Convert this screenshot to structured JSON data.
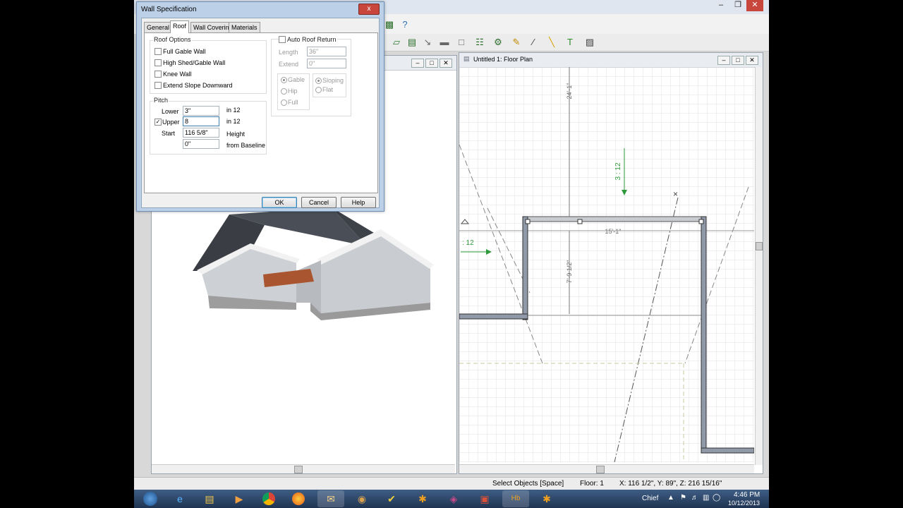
{
  "dialog": {
    "title": "Wall Specification",
    "close_label": "x",
    "tabs": [
      {
        "label": "General"
      },
      {
        "label": "Roof"
      },
      {
        "label": "Wall Covering"
      },
      {
        "label": "Materials"
      }
    ],
    "active_tab": "Roof",
    "roof_options": {
      "title": "Roof Options",
      "items": [
        {
          "label": "Full Gable Wall",
          "checked": false
        },
        {
          "label": "High Shed/Gable Wall",
          "checked": false
        },
        {
          "label": "Knee Wall",
          "checked": false
        },
        {
          "label": "Extend Slope Downward",
          "checked": false
        }
      ]
    },
    "pitch": {
      "title": "Pitch",
      "lower_label": "Lower",
      "lower_value": "3\"",
      "lower_unit": "in 12",
      "upper_label": "Upper",
      "upper_checked": true,
      "upper_value": "8",
      "upper_unit": "in 12",
      "start_label": "Start",
      "start_value": "116 5/8\"",
      "start_unit": "Height",
      "baseline_value": "0\"",
      "baseline_unit": "from Baseline"
    },
    "auto_return": {
      "label": "Auto Roof Return",
      "checked": false,
      "length_label": "Length",
      "length_value": "36\"",
      "extend_label": "Extend",
      "extend_value": "0\"",
      "type_options": [
        {
          "label": "Gable",
          "selected": true
        },
        {
          "label": "Hip",
          "selected": false
        },
        {
          "label": "Full",
          "selected": false
        }
      ],
      "slope_options": [
        {
          "label": "Sloping",
          "selected": true
        },
        {
          "label": "Flat",
          "selected": false
        }
      ]
    },
    "buttons": {
      "ok": "OK",
      "cancel": "Cancel",
      "help": "Help"
    }
  },
  "floor_plan": {
    "title": "Untitled 1: Floor Plan",
    "dimensions": {
      "top": "24'-1\"",
      "wall_width": "15'-1\"",
      "wall_depth": "7'-9 1/2\"",
      "pitch_marker": "3 : 12",
      "pitch_left": ": 12"
    }
  },
  "status_bar": {
    "mode": "Select Objects [Space]",
    "floor": "Floor: 1",
    "coords": "X: 116 1/2\", Y: 89\", Z: 216 15/16\""
  },
  "taskbar": {
    "apps": [
      {
        "icon": "start-orb-icon"
      },
      {
        "icon": "internet-explorer-icon"
      },
      {
        "icon": "file-explorer-icon"
      },
      {
        "icon": "media-player-icon"
      },
      {
        "icon": "chrome-icon"
      },
      {
        "icon": "firefox-icon"
      },
      {
        "icon": "outlook-icon"
      },
      {
        "icon": "paint-icon"
      },
      {
        "icon": "norton-icon"
      },
      {
        "icon": "chief-architect-icon"
      },
      {
        "icon": "corel-icon"
      },
      {
        "icon": "photo-app-icon"
      },
      {
        "icon": "home-designer-icon"
      },
      {
        "icon": "asterisk-app-icon"
      }
    ],
    "tray_label": "Chief",
    "time": "4:46 PM",
    "date": "10/12/2013"
  },
  "colors": {
    "wall": "#8f99a8",
    "dimension_green": "#2e9a3b",
    "taskbar": "#2a4468",
    "deck": "#a9552f"
  }
}
